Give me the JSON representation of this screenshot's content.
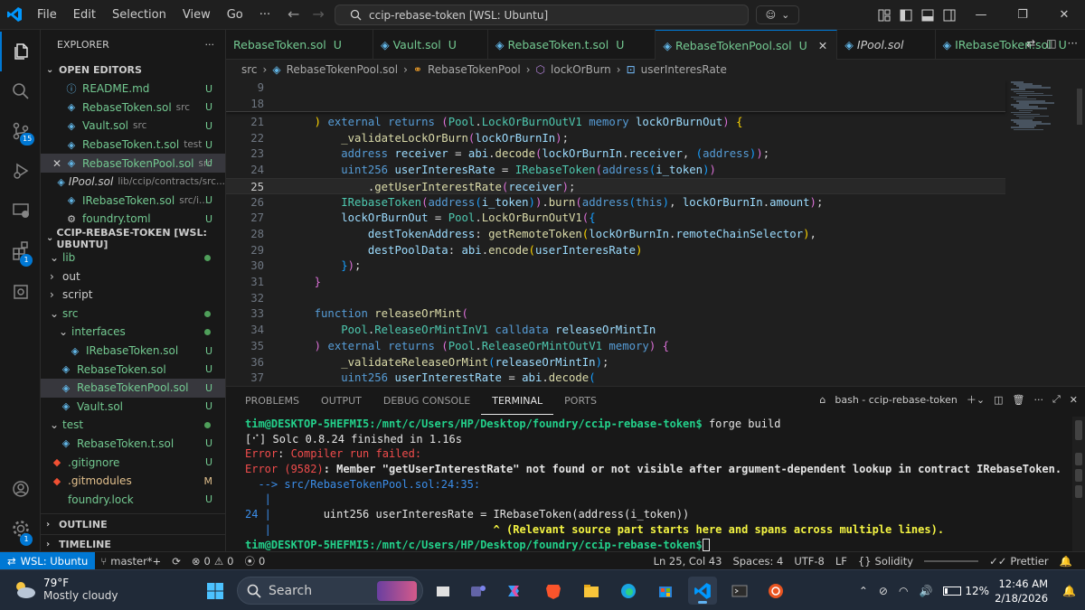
{
  "titlebar": {
    "menu": [
      "File",
      "Edit",
      "Selection",
      "View",
      "Go",
      "···"
    ],
    "command_center": "ccip-rebase-token [WSL: Ubuntu]"
  },
  "activity": {
    "source_control_badge": "15",
    "extensions_badge": "1",
    "settings_badge": "1"
  },
  "explorer": {
    "title": "EXPLORER",
    "open_editors_label": "OPEN EDITORS",
    "open_editors": [
      {
        "name": "README.md",
        "path": "",
        "status": "U"
      },
      {
        "name": "RebaseToken.sol",
        "path": "src",
        "status": "U"
      },
      {
        "name": "Vault.sol",
        "path": "src",
        "status": "U"
      },
      {
        "name": "RebaseToken.t.sol",
        "path": "test",
        "status": "U"
      },
      {
        "name": "RebaseTokenPool.sol",
        "path": "src",
        "status": "U"
      },
      {
        "name": "IPool.sol",
        "path": "lib/ccip/contracts/src...",
        "status": ""
      },
      {
        "name": "IRebaseToken.sol",
        "path": "src/i...",
        "status": "U"
      },
      {
        "name": "foundry.toml",
        "path": "",
        "status": "U"
      }
    ],
    "project_label": "CCIP-REBASE-TOKEN [WSL: UBUNTU]",
    "tree": [
      {
        "name": "lib",
        "status": "",
        "dot": true
      },
      {
        "name": "out",
        "status": "",
        "dot": false
      },
      {
        "name": "script",
        "status": "",
        "dot": false
      },
      {
        "name": "src",
        "status": "",
        "dot": true
      },
      {
        "name": "interfaces",
        "status": "",
        "dot": true
      },
      {
        "name": "IRebaseToken.sol",
        "status": "U",
        "dot": false
      },
      {
        "name": "RebaseToken.sol",
        "status": "U",
        "dot": false
      },
      {
        "name": "RebaseTokenPool.sol",
        "status": "U",
        "dot": false
      },
      {
        "name": "Vault.sol",
        "status": "U",
        "dot": false
      },
      {
        "name": "test",
        "status": "",
        "dot": true
      },
      {
        "name": "RebaseToken.t.sol",
        "status": "U",
        "dot": false
      },
      {
        "name": ".gitignore",
        "status": "U",
        "dot": false
      },
      {
        "name": ".gitmodules",
        "status": "M",
        "dot": false
      },
      {
        "name": "foundry.lock",
        "status": "U",
        "dot": false
      }
    ],
    "outline_label": "OUTLINE",
    "timeline_label": "TIMELINE"
  },
  "tabs": [
    {
      "name": "RebaseToken.sol",
      "status": "U"
    },
    {
      "name": "Vault.sol",
      "status": "U"
    },
    {
      "name": "RebaseToken.t.sol",
      "status": "U"
    },
    {
      "name": "RebaseTokenPool.sol",
      "status": "U"
    },
    {
      "name": "IPool.sol",
      "status": ""
    },
    {
      "name": "IRebaseToken.sol",
      "status": "U"
    }
  ],
  "breadcrumb": [
    "src",
    "RebaseTokenPool.sol",
    "RebaseTokenPool",
    "lockOrBurn",
    "userInteresRate"
  ],
  "editor": {
    "sticky_lines": [
      "9",
      "18"
    ],
    "line_numbers": [
      "21",
      "22",
      "23",
      "24",
      "25",
      "26",
      "27",
      "28",
      "29",
      "30",
      "31",
      "32",
      "33",
      "34",
      "35",
      "36",
      "37"
    ],
    "current_line": "25"
  },
  "panel": {
    "tabs": [
      "PROBLEMS",
      "OUTPUT",
      "DEBUG CONSOLE",
      "TERMINAL",
      "PORTS"
    ],
    "terminal_name": "bash - ccip-rebase-token",
    "prompt": "tim@DESKTOP-5HEFMI5:/mnt/c/Users/HP/Desktop/foundry/ccip-rebase-token$",
    "command": " forge build",
    "solc_line": "[⠊] Solc 0.8.24 finished in 1.16s",
    "error_label": "Error",
    "compiler_failed": "Compiler run failed:",
    "error_code": "(9582)",
    "error_msg": ": Member \"getUserInterestRate\" not found or not visible after argument-dependent lookup in contract IRebaseToken.",
    "location": "  --> src/RebaseTokenPool.sol:24:35:",
    "pipe": "   |",
    "src_lineno": "24",
    "src_code": "        uint256 userInteresRate = IRebaseToken(address(i_token))",
    "caret_line": "                                  ^ (Relevant source part starts here and spans across multiple lines)."
  },
  "statusbar": {
    "remote": "WSL: Ubuntu",
    "branch": "master*+",
    "errors": "0",
    "warnings": "0",
    "ports": "0",
    "position": "Ln 25, Col 43",
    "spaces": "Spaces: 4",
    "encoding": "UTF-8",
    "eol": "LF",
    "language": "Solidity",
    "formatter": "Prettier"
  },
  "taskbar": {
    "temp": "79°F",
    "weather": "Mostly cloudy",
    "search": "Search",
    "battery": "12%",
    "time": "12:46 AM",
    "date": "2/18/2026"
  }
}
